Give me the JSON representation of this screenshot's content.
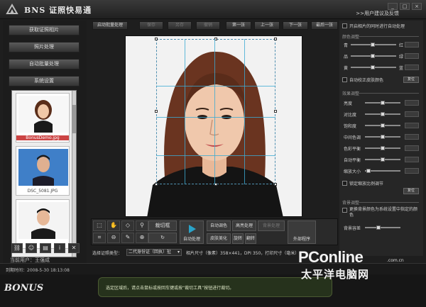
{
  "app": {
    "title": "BNS 证照快易通",
    "feedback_link": ">>用户建议及反馈",
    "window_controls": [
      "_",
      "□",
      "×"
    ]
  },
  "left_nav": {
    "buttons": [
      "获取证照相片",
      "照片处理",
      "自动批量处理",
      "系统设置"
    ]
  },
  "thumbnails": [
    {
      "caption": "BonusDemo.jpg",
      "selected": true
    },
    {
      "caption": "DSC_5081.JPG",
      "selected": false
    },
    {
      "caption": "",
      "selected": false
    }
  ],
  "left_tools": [
    "link-icon",
    "people-icon",
    "document-icon",
    "info-icon",
    "trash-icon"
  ],
  "current_user": "当前用户：王强成",
  "top_toolbar": [
    {
      "label": "启动批量处理",
      "disabled": false
    },
    {
      "label": "保存",
      "disabled": true
    },
    {
      "label": "另存",
      "disabled": true
    },
    {
      "label": "撤销",
      "disabled": true
    },
    {
      "label": "第一张",
      "disabled": false
    },
    {
      "label": "上一张",
      "disabled": false
    },
    {
      "label": "下一张",
      "disabled": false
    },
    {
      "label": "最后一张",
      "disabled": false
    }
  ],
  "bottom_tools": {
    "crop_tool": "裁切框",
    "auto_process": "自动处理",
    "auto_color": "自动调色",
    "highlight": "高亮处理",
    "background": "背景处理",
    "skin": "皮肤美化",
    "rotate": "旋转",
    "flip": "翻转",
    "external": "外部程序"
  },
  "cert": {
    "label": "选择证照类型：",
    "value": "二代身份证（回执）扯",
    "photo_size": "相片尺寸（像素）358×441，DPI 350，打印尺寸（毫米）"
  },
  "right_panel": {
    "auto_process_on_get": "开启相片的同时进行自动处理",
    "color_section": "颜色调整",
    "color_rows": [
      {
        "left": "青",
        "right": "红"
      },
      {
        "left": "品",
        "right": "绿"
      },
      {
        "left": "黄",
        "right": "蓝"
      }
    ],
    "auto_skin": "自动校正皮肤颜色",
    "reset": "复位",
    "effect_section": "效果调整",
    "effect_rows": [
      "亮度",
      "对比度",
      "饱和度",
      "中间色调",
      "色彩平衡",
      "自动平衡",
      "缩放大小"
    ],
    "keep_ratio": "锁定缩放比例调节",
    "bg_section": "背景调整",
    "bg_option": "更换背景颜色为系统设置中指定的颜色",
    "bg_tolerance": "背景容差"
  },
  "status": "到期时间：2008-5-30 18:13:08",
  "hint": "选定区域后，请点击鼠标或按回车键或按“裁切工具”按钮进行裁切。",
  "brand": "BONUS",
  "watermark": {
    "brand": "PConline",
    "domain": ".com.cn",
    "cn": "太平洋电脑网"
  }
}
